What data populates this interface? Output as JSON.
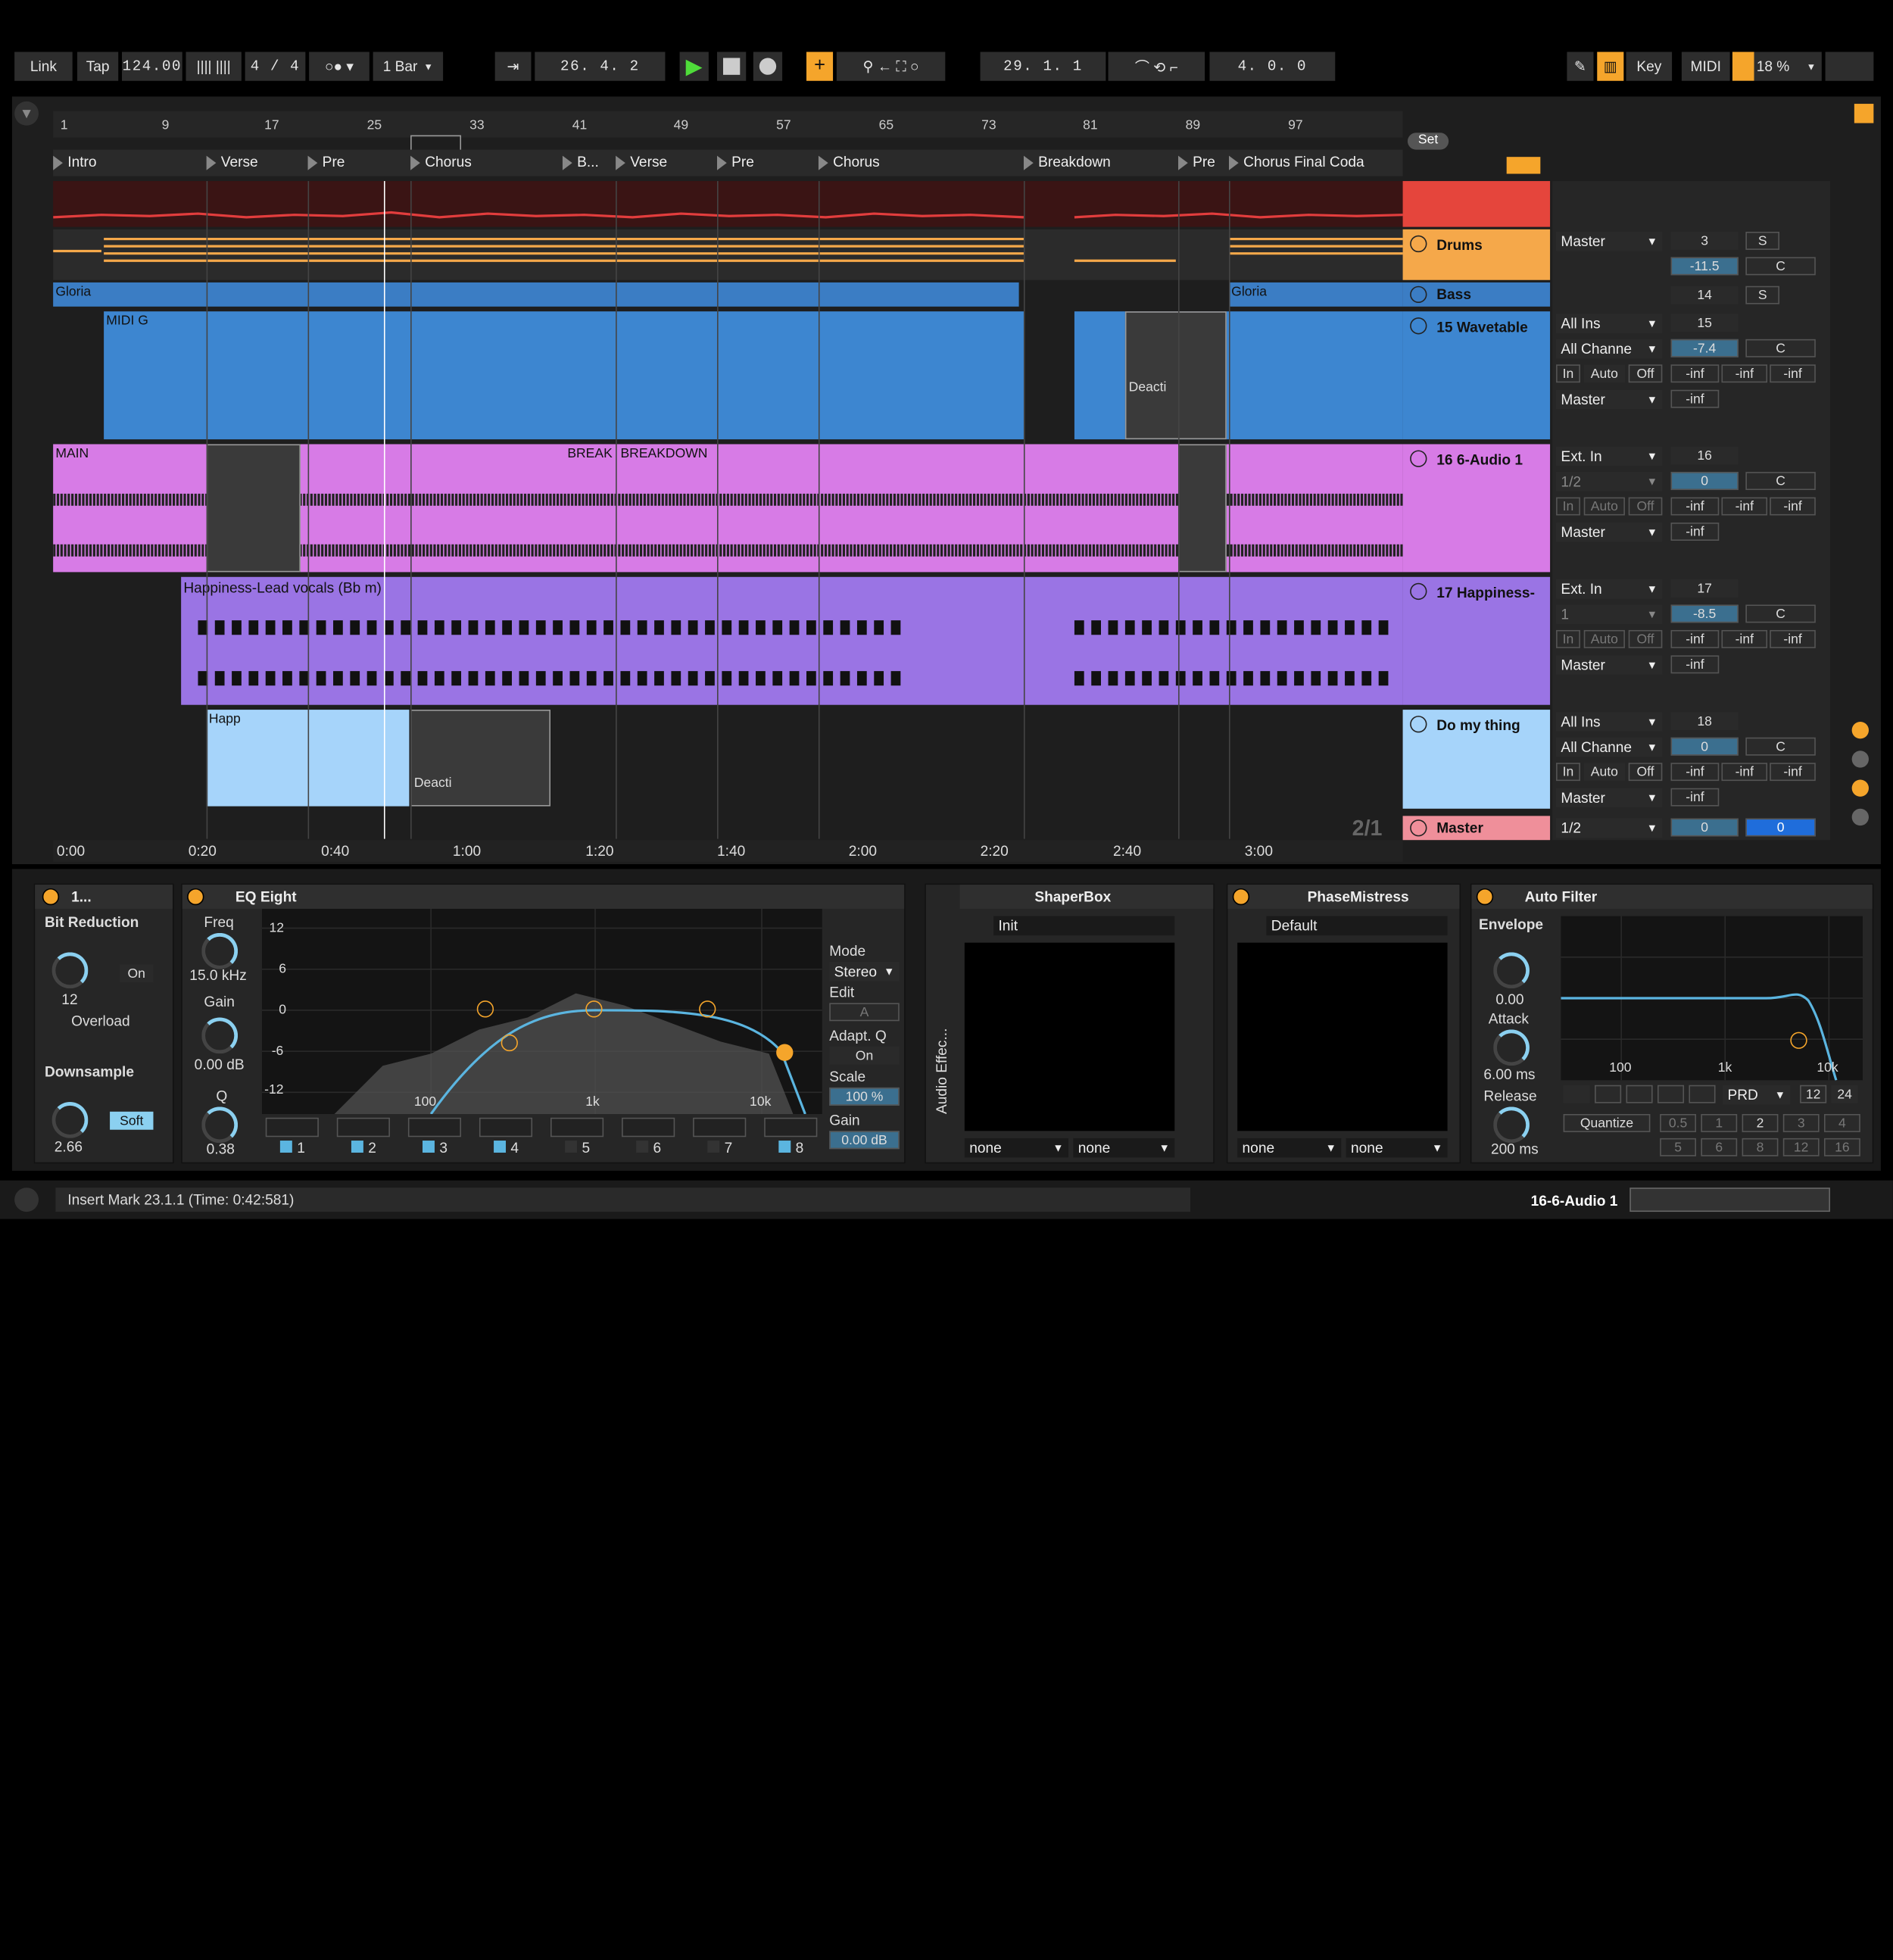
{
  "transport": {
    "link": "Link",
    "tap": "Tap",
    "tempo": "124.00",
    "sig": "4 / 4",
    "quantize": "1 Bar",
    "arrangement_pos": "26.  4.  2",
    "loop_start": "29.  1.  1",
    "loop_len": "4.  0.  0",
    "key": "Key",
    "midi": "MIDI",
    "cpu": "18 %"
  },
  "ruler": {
    "bars": [
      "1",
      "9",
      "17",
      "25",
      "33",
      "41",
      "49",
      "57",
      "65",
      "73",
      "81",
      "89",
      "97"
    ],
    "times": [
      "0:00",
      "0:20",
      "0:40",
      "1:00",
      "1:20",
      "1:40",
      "2:00",
      "2:20",
      "2:40",
      "3:00"
    ],
    "set": "Set",
    "page": "2/1"
  },
  "locators": [
    "Intro",
    "Verse",
    "Pre",
    "Chorus",
    "B...",
    "Verse",
    "Pre",
    "Chorus",
    "Breakdown",
    "Pre",
    "Chorus Final Coda"
  ],
  "tracks": {
    "drums": {
      "name": "Drums",
      "out": "Master",
      "num": "3",
      "vol": "-11.5",
      "solo": "S",
      "pan": "C"
    },
    "bass": {
      "name": "Bass",
      "num": "14",
      "solo": "S",
      "clip": "Gloria"
    },
    "wavetable": {
      "name": "15 Wavetable",
      "in": "All Ins",
      "ch": "All Channe",
      "out": "Master",
      "num": "15",
      "vol": "-7.4",
      "pan": "C",
      "clip": "MIDI G",
      "deact": "Deacti"
    },
    "audio": {
      "name": "16 6-Audio 1",
      "in": "Ext. In",
      "ch": "1/2",
      "out": "Master",
      "num": "16",
      "vol": "0",
      "pan": "C",
      "clip_main": "MAIN",
      "clip_break": "BREAK",
      "clip_bd": "BREAKDOWN"
    },
    "happiness": {
      "name": "17 Happiness-",
      "in": "Ext. In",
      "ch": "1",
      "out": "Master",
      "num": "17",
      "vol": "-8.5",
      "pan": "C",
      "clip": "Happiness-Lead vocals (Bb m)"
    },
    "domything": {
      "name": "Do my thing",
      "in": "All Ins",
      "ch": "All Channe",
      "out": "Master",
      "num": "18",
      "vol": "0",
      "pan": "C",
      "clip": "Happ",
      "deact": "Deacti"
    },
    "master": {
      "name": "Master",
      "ch": "1/2",
      "vol": "0",
      "vol2": "0"
    }
  },
  "mon": {
    "in": "In",
    "auto": "Auto",
    "off": "Off",
    "inf": "-inf"
  },
  "devices": {
    "bitred": {
      "title": "1...",
      "label": "Bit Reduction",
      "val": "12",
      "on": "On",
      "overload": "Overload",
      "down": "Downsample",
      "downval": "2.66",
      "soft": "Soft"
    },
    "eq": {
      "title": "EQ Eight",
      "freq": "Freq",
      "freqval": "15.0 kHz",
      "gain": "Gain",
      "gainval": "0.00 dB",
      "q": "Q",
      "qval": "0.38",
      "mode": "Mode",
      "modeval": "Stereo",
      "edit": "Edit",
      "editval": "A",
      "adapt": "Adapt. Q",
      "adaptval": "On",
      "scale": "Scale",
      "scaleval": "100 %",
      "gain2": "Gain",
      "gain2val": "0.00 dB",
      "db": [
        "12",
        "6",
        "0",
        "-6",
        "-12"
      ],
      "hz": [
        "100",
        "1k",
        "10k"
      ],
      "bands": [
        "1",
        "2",
        "3",
        "4",
        "5",
        "6",
        "7",
        "8"
      ]
    },
    "rack": {
      "label": "Audio Effec..."
    },
    "shaper": {
      "title": "ShaperBox",
      "preset": "Init",
      "a": "none",
      "b": "none"
    },
    "phase": {
      "title": "PhaseMistress",
      "preset": "Default",
      "a": "none",
      "b": "none"
    },
    "autofilter": {
      "title": "Auto Filter",
      "env": "Envelope",
      "envval": "0.00",
      "attack": "Attack",
      "attackval": "6.00 ms",
      "release": "Release",
      "releaseval": "200 ms",
      "hz": [
        "100",
        "1k",
        "10k"
      ],
      "prd": "PRD",
      "n12": "12",
      "n24": "24",
      "quantize": "Quantize",
      "q": [
        "0.5",
        "1",
        "2",
        "3",
        "4",
        "5",
        "6",
        "8",
        "12",
        "16"
      ]
    }
  },
  "status": {
    "msg": "Insert Mark 23.1.1 (Time: 0:42:581)",
    "track": "16-6-Audio 1"
  },
  "colors": {
    "accent": "#f5a52b",
    "drums": "#f5a84a",
    "bass": "#3b7dc4",
    "wavetable": "#3d86d0",
    "audio": "#d77be6",
    "happiness": "#9a74e4",
    "domything": "#a6d4fa",
    "master": "#ef8f9a"
  }
}
